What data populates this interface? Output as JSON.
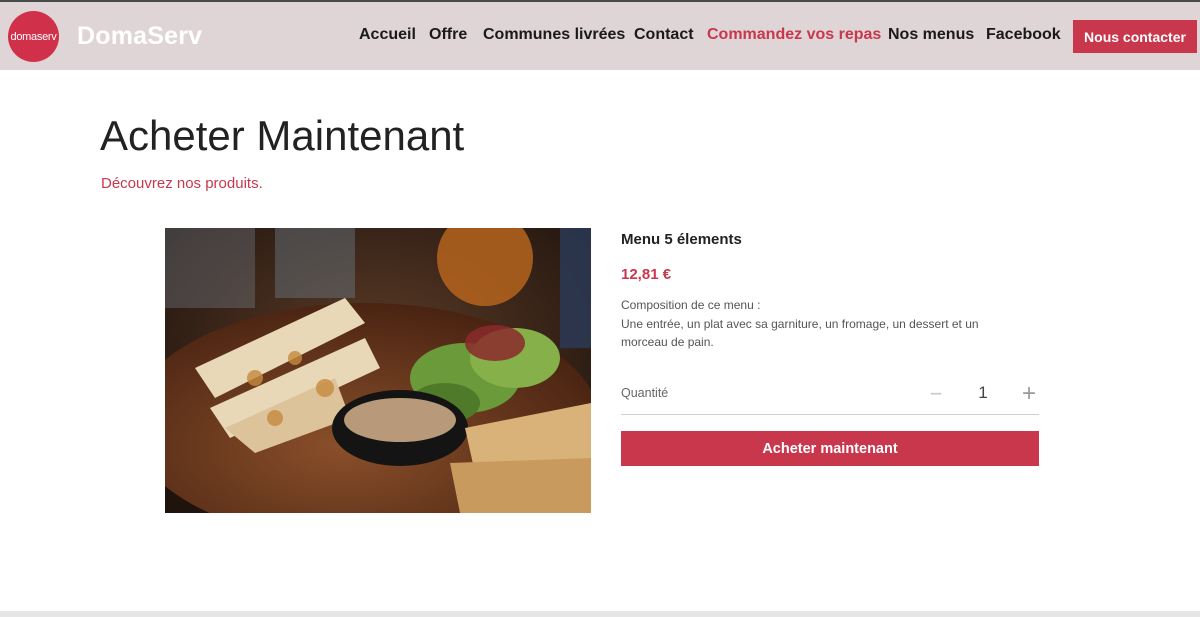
{
  "header": {
    "logo_text": "domaserv",
    "brand": "DomaServ",
    "nav": [
      {
        "label": "Accueil",
        "active": false
      },
      {
        "label": "Offre",
        "active": false
      },
      {
        "label": "Communes livrées",
        "active": false
      },
      {
        "label": "Contact",
        "active": false
      },
      {
        "label": "Commandez vos repas",
        "active": true
      },
      {
        "label": "Nos menus",
        "active": false
      },
      {
        "label": "Facebook",
        "active": false
      }
    ],
    "cta_label": "Nous contacter"
  },
  "page": {
    "title": "Acheter Maintenant",
    "subtitle": "Découvrez nos produits."
  },
  "product": {
    "image_icon": "food-plate-photo",
    "name": "Menu 5 élements",
    "price": "12,81 €",
    "description_title": "Composition de ce menu :",
    "description": "Une entrée, un plat avec sa garniture, un fromage, un dessert et un morceau de pain.",
    "quantity_label": "Quantité",
    "quantity": "1",
    "minus_icon": "minus-icon",
    "plus_icon": "plus-icon",
    "buy_label": "Acheter maintenant"
  },
  "colors": {
    "accent": "#c9374d",
    "header_bg": "#e0d5d6"
  }
}
